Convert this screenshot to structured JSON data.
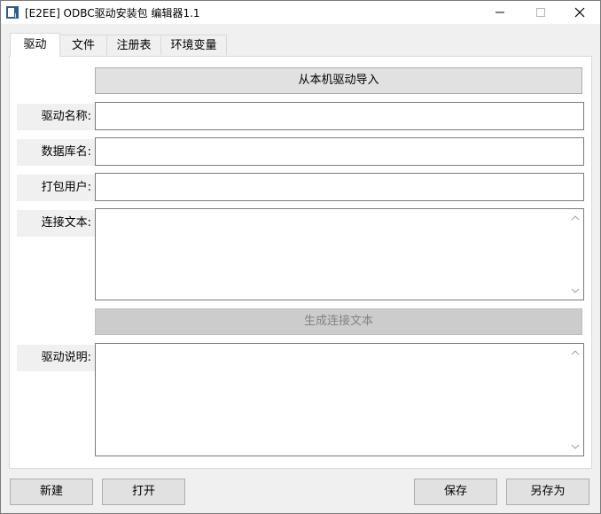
{
  "window": {
    "title": "[E2EE] ODBC驱动安装包 编辑器1.1"
  },
  "tabs": [
    {
      "label": "驱动"
    },
    {
      "label": "文件"
    },
    {
      "label": "注册表"
    },
    {
      "label": "环境变量"
    }
  ],
  "driver_tab": {
    "import_button": "从本机驱动导入",
    "driver_name_label": "驱动名称:",
    "driver_name_value": "",
    "database_name_label": "数据库名:",
    "database_name_value": "",
    "package_user_label": "打包用户:",
    "package_user_value": "",
    "connection_text_label": "连接文本:",
    "connection_text_value": "",
    "generate_button": "生成连接文本",
    "description_label": "驱动说明:",
    "description_value": ""
  },
  "footer": {
    "new_label": "新建",
    "open_label": "打开",
    "save_label": "保存",
    "save_as_label": "另存为"
  }
}
